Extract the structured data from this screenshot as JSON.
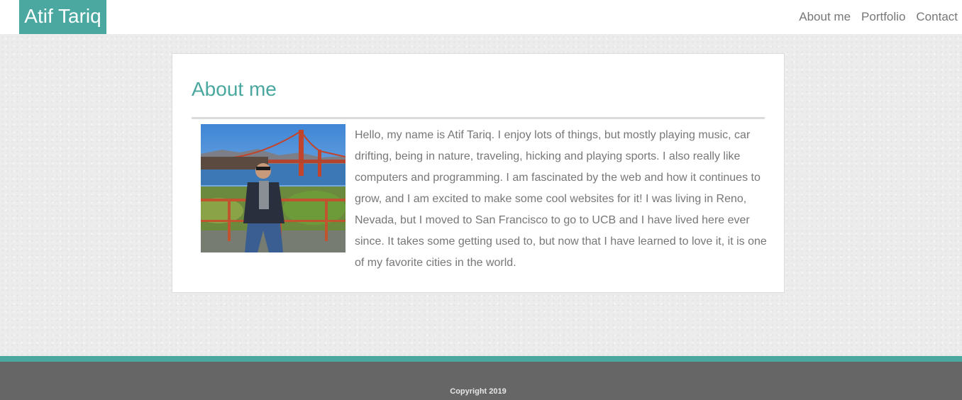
{
  "header": {
    "brand": "Atif Tariq",
    "nav": [
      {
        "label": "About me"
      },
      {
        "label": "Portfolio"
      },
      {
        "label": "Contact"
      }
    ]
  },
  "about": {
    "title": "About me",
    "bio": "Hello, my name is Atif Tariq. I enjoy lots of things, but mostly playing music, car drifting, being in nature, traveling, hicking and playing sports. I also really like computers and programming. I am fascinated by the web and how it continues to grow, and I am excited to make some cool websites for it! I was living in Reno, Nevada, but I moved to San Francisco to go to UCB and I have lived here ever since. It takes some getting used to, but now that I have learned to love it, it is one of my favorite cities in the world."
  },
  "footer": {
    "copyright": "Copyright 2019"
  },
  "colors": {
    "accent": "#4aa8a0",
    "footer": "#666666",
    "text": "#777777"
  }
}
